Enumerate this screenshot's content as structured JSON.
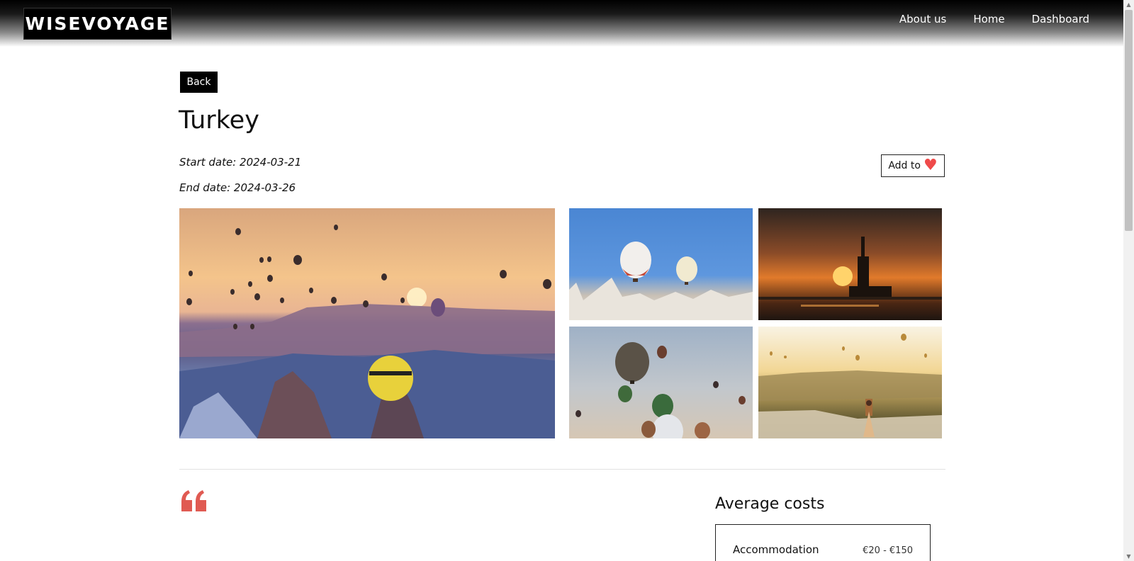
{
  "header": {
    "logo": "WISEVOYAGE",
    "nav": [
      "About us",
      "Home",
      "Dashboard"
    ]
  },
  "page": {
    "back_label": "Back",
    "title": "Turkey",
    "start_date": "Start date: 2024-03-21",
    "end_date": "End date: 2024-03-26",
    "favorite_label": "Add to"
  },
  "icons": {
    "heart": "heart-icon",
    "quote": "quote-icon"
  },
  "costs": {
    "title": "Average costs",
    "items": [
      {
        "label": "Accommodation",
        "value": "€20 - €150"
      }
    ]
  },
  "colors": {
    "accent_red": "#ef4a4a",
    "header_black": "#000000"
  }
}
